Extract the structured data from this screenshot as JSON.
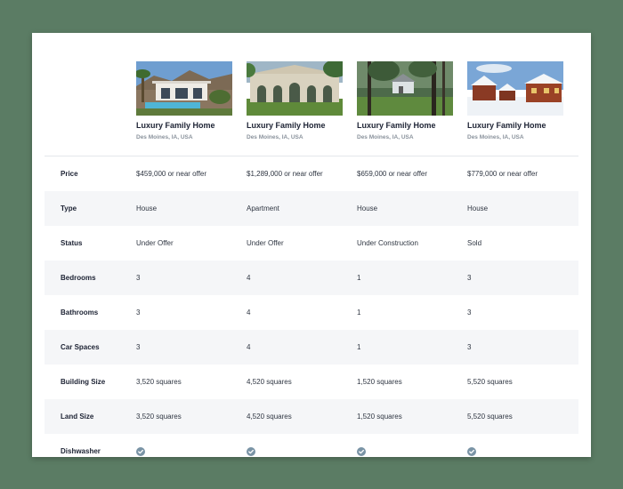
{
  "colors": {
    "background": "#5b7c64",
    "card": "#ffffff",
    "row_alt": "#f5f6f8",
    "text_dark": "#1c2233",
    "text_muted": "#8a929c",
    "check": "#7a94a6"
  },
  "listings": [
    {
      "title": "Luxury Family Home",
      "location": "Des Moines, IA, USA",
      "photo": "modern-villa-photo"
    },
    {
      "title": "Luxury Family Home",
      "location": "Des Moines, IA, USA",
      "photo": "arched-mansion-photo"
    },
    {
      "title": "Luxury Family Home",
      "location": "Des Moines, IA, USA",
      "photo": "forest-cabin-photo"
    },
    {
      "title": "Luxury Family Home",
      "location": "Des Moines, IA, USA",
      "photo": "snow-chalet-photo"
    }
  ],
  "rows": [
    {
      "label": "Price",
      "values": [
        "$459,000 or near offer",
        "$1,289,000 or near offer",
        "$659,000 or near offer",
        "$779,000 or near offer"
      ]
    },
    {
      "label": "Type",
      "values": [
        "House",
        "Apartment",
        "House",
        "House"
      ]
    },
    {
      "label": "Status",
      "values": [
        "Under Offer",
        "Under Offer",
        "Under Construction",
        "Sold"
      ]
    },
    {
      "label": "Bedrooms",
      "values": [
        "3",
        "4",
        "1",
        "3"
      ]
    },
    {
      "label": "Bathrooms",
      "values": [
        "3",
        "4",
        "1",
        "3"
      ]
    },
    {
      "label": "Car Spaces",
      "values": [
        "3",
        "4",
        "1",
        "3"
      ]
    },
    {
      "label": "Building Size",
      "values": [
        "3,520 squares",
        "4,520 squares",
        "1,520 squares",
        "5,520 squares"
      ]
    },
    {
      "label": "Land Size",
      "values": [
        "3,520 squares",
        "4,520 squares",
        "1,520 squares",
        "5,520 squares"
      ]
    },
    {
      "label": "Dishwasher",
      "checks": [
        true,
        true,
        true,
        true
      ],
      "icon": "check-circle-icon"
    }
  ]
}
